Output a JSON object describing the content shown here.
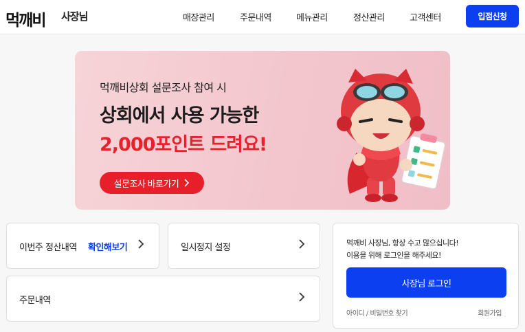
{
  "header": {
    "logo": "먹깨비",
    "logo_sub": "사장님",
    "nav": [
      "매장관리",
      "주문내역",
      "메뉴관리",
      "정산관리",
      "고객센터"
    ],
    "cta_label": "입점신청"
  },
  "banner": {
    "line1": "먹깨비상회 설문조사 참여 시",
    "line2": "상회에서 사용 가능한",
    "line3": "2,000포인트 드려요!",
    "button_label": "설문조사 바로가기"
  },
  "cards": {
    "settlement_label": "이번주 정산내역",
    "settlement_link": "확인해보기",
    "pause_label": "일시정지 설정",
    "orders_label": "주문내역"
  },
  "login": {
    "message_line1": "먹깨비 사장님, 항상 수고 많으십니다!",
    "message_line2": "이용을 위해 로그인을 해주세요!",
    "button_label": "사장님 로그인",
    "find_label": "아이디 / 비밀번호 찾기",
    "join_label": "회원가입"
  },
  "colors": {
    "accent": "#0b3ff0",
    "banner_red": "#e71f2a",
    "banner_bg": "#f3c6cd"
  }
}
